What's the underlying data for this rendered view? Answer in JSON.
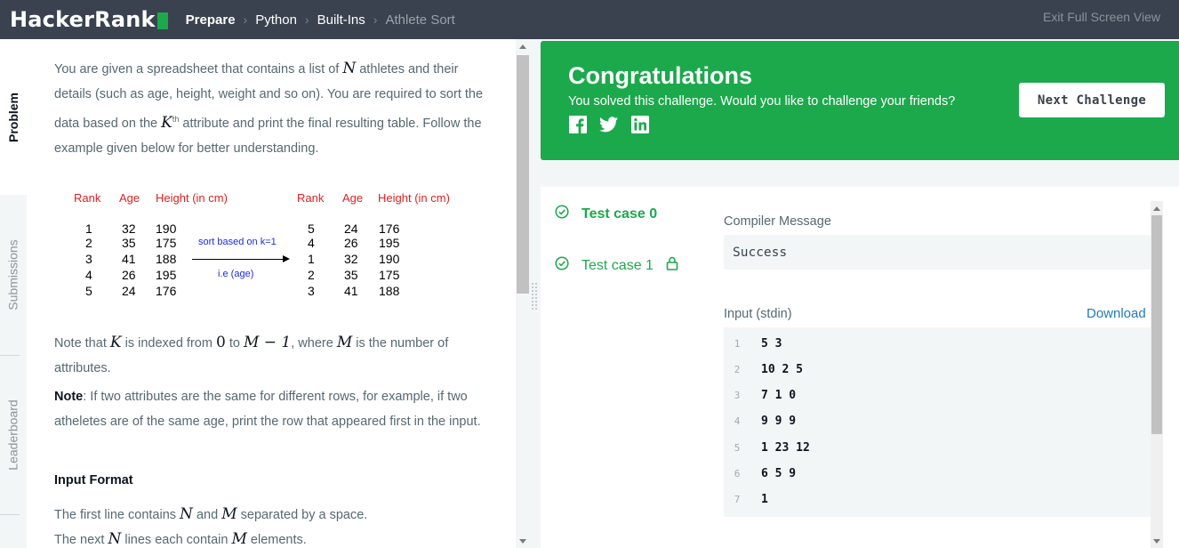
{
  "topbar": {
    "logo_text": "HackerRank",
    "breadcrumbs": [
      "Prepare",
      "Python",
      "Built-Ins",
      "Athlete Sort"
    ],
    "exit_fullscreen": "Exit Full Screen View"
  },
  "rail": {
    "tabs": [
      "Problem",
      "Submissions",
      "Leaderboard"
    ],
    "active": "Problem"
  },
  "problem": {
    "intro_1": "You are given a spreadsheet that contains a list of",
    "intro_N": "N",
    "intro_2": "athletes and their details (such as age, height, weight and so on). You are required to sort the data based on the",
    "intro_K": "K",
    "intro_sup": "th",
    "intro_3": "attribute and print the final resulting table. Follow the example given below for better understanding.",
    "figure": {
      "headers": [
        "Rank",
        "Age",
        "Height (in cm)"
      ],
      "left_rows": [
        [
          "1",
          "32",
          "190"
        ],
        [
          "2",
          "35",
          "175"
        ],
        [
          "3",
          "41",
          "188"
        ],
        [
          "4",
          "26",
          "195"
        ],
        [
          "5",
          "24",
          "176"
        ]
      ],
      "right_rows": [
        [
          "5",
          "24",
          "176"
        ],
        [
          "4",
          "26",
          "195"
        ],
        [
          "1",
          "32",
          "190"
        ],
        [
          "2",
          "35",
          "175"
        ],
        [
          "3",
          "41",
          "188"
        ]
      ],
      "arrow_label_top": "sort based on k=1",
      "arrow_label_bottom": "i.e (age)"
    },
    "note1_a": "Note that",
    "note1_K": "K",
    "note1_b": "is indexed from",
    "note1_zero": "0",
    "note1_c": "to",
    "note1_expr": "M − 1",
    "note1_d": ", where",
    "note1_M": "M",
    "note1_e": "is the number of attributes.",
    "note2_label": "Note",
    "note2_text": ": If two attributes are the same for different rows, for example, if two atheletes are of the same age, print the row that appeared first in the input.",
    "input_format_heading": "Input Format",
    "if_line1_a": "The first line contains",
    "if_line1_N": "N",
    "if_line1_b": "and",
    "if_line1_M": "M",
    "if_line1_c": "separated by a space.",
    "if_line2_a": "The next",
    "if_line2_N": "N",
    "if_line2_b": "lines each contain",
    "if_line2_M": "M",
    "if_line2_c": "elements."
  },
  "banner": {
    "title": "Congratulations",
    "subtitle": "You solved this challenge. Would you like to challenge your friends?",
    "social_icons": [
      "facebook-icon",
      "twitter-icon",
      "linkedin-icon"
    ],
    "next_button": "Next Challenge",
    "color": "#1ba94c"
  },
  "results": {
    "test_cases": [
      {
        "label": "Test case 0",
        "status": "passed",
        "locked": false
      },
      {
        "label": "Test case 1",
        "status": "passed",
        "locked": true
      }
    ],
    "compiler_message_label": "Compiler Message",
    "compiler_message": "Success",
    "input_label": "Input (stdin)",
    "download_label": "Download",
    "input_lines": [
      {
        "n": "1",
        "text": "5 3"
      },
      {
        "n": "2",
        "text": "10 2 5"
      },
      {
        "n": "3",
        "text": "7 1 0"
      },
      {
        "n": "4",
        "text": "9 9 9"
      },
      {
        "n": "5",
        "text": "1 23 12"
      },
      {
        "n": "6",
        "text": "6 5 9"
      },
      {
        "n": "7",
        "text": "1"
      }
    ]
  }
}
